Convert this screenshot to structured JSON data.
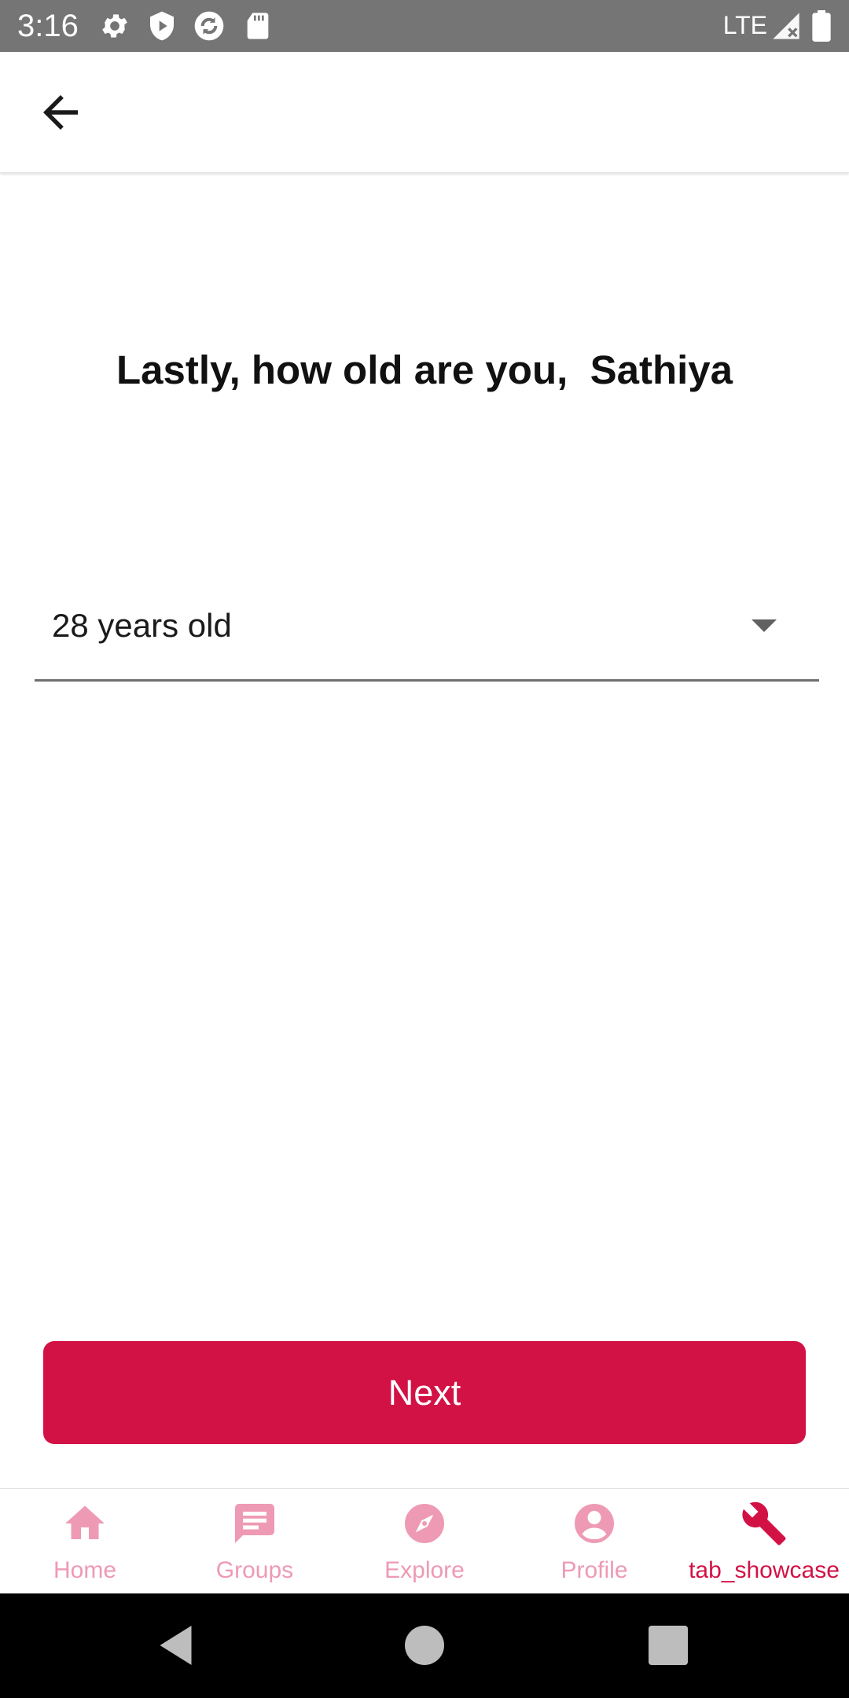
{
  "status_bar": {
    "time": "3:16",
    "network": "LTE",
    "icons": [
      "gear-icon",
      "shield-play-icon",
      "sync-icon",
      "sd-card-icon",
      "signal-icon",
      "battery-icon"
    ]
  },
  "app_bar": {
    "back_icon": "arrow-back-icon"
  },
  "main": {
    "heading": "Lastly, how old are you,  Sathiya",
    "age_select": {
      "value": "28 years old",
      "arrow_icon": "dropdown-arrow-icon"
    },
    "next_button_label": "Next"
  },
  "bottom_nav": {
    "items": [
      {
        "label": "Home",
        "icon": "home-icon",
        "active": false
      },
      {
        "label": "Groups",
        "icon": "chat-icon",
        "active": false
      },
      {
        "label": "Explore",
        "icon": "compass-icon",
        "active": false
      },
      {
        "label": "Profile",
        "icon": "account-icon",
        "active": false
      },
      {
        "label": "tab_showcase",
        "icon": "wrench-icon",
        "active": true
      }
    ]
  },
  "system_nav": {
    "buttons": [
      "back-triangle-icon",
      "home-circle-icon",
      "recents-square-icon"
    ]
  },
  "colors": {
    "accent": "#d21245",
    "inactive_nav": "#ee9ab4",
    "status_bar": "#757575",
    "system_nav": "#000000"
  }
}
